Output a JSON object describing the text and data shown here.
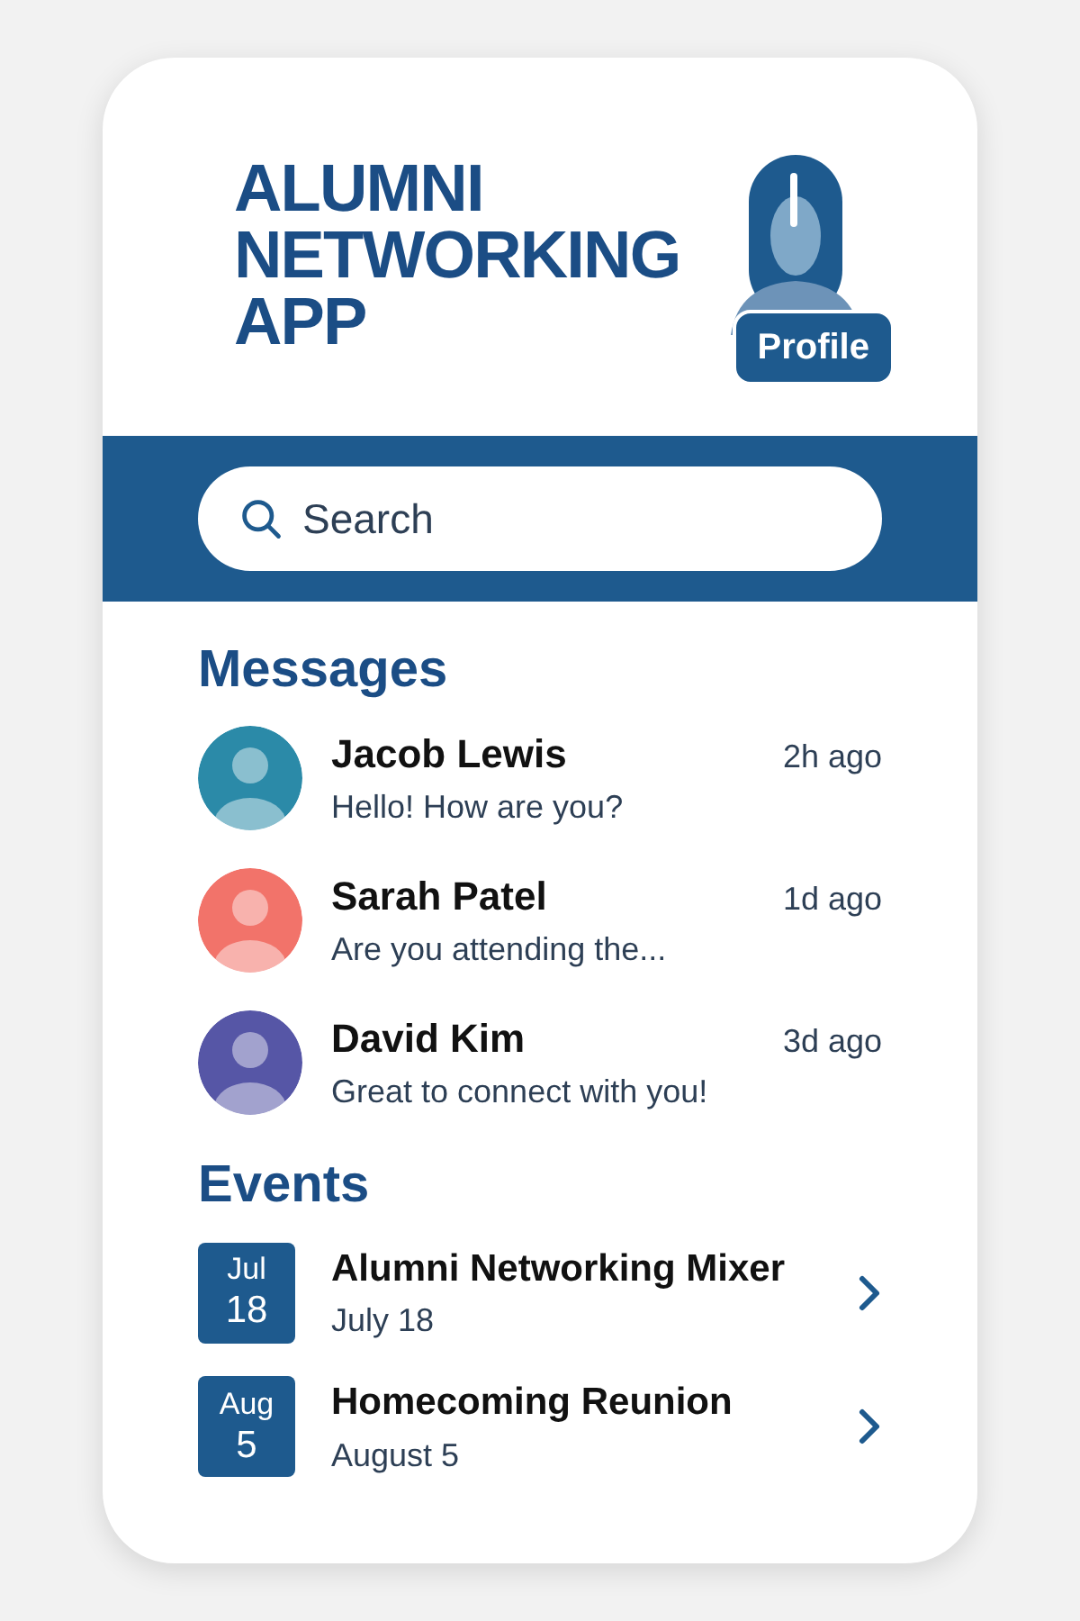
{
  "header": {
    "title": [
      "ALUMNI",
      "NETWORKING",
      "APP"
    ],
    "profile_button": "Profile"
  },
  "search": {
    "placeholder": "Search"
  },
  "messages": {
    "heading": "Messages",
    "items": [
      {
        "name": "Jacob Lewis",
        "time": "2h ago",
        "preview": "Hello! How are you?",
        "color": "#2b8aa8"
      },
      {
        "name": "Sarah Patel",
        "time": "1d ago",
        "preview": "Are you attending the...",
        "color": "#f2736a"
      },
      {
        "name": "David Kim",
        "time": "3d ago",
        "preview": "Great to connect with you!",
        "color": "#5656a6"
      }
    ]
  },
  "events": {
    "heading": "Events",
    "items": [
      {
        "month": "Jul",
        "day": "18",
        "title": "Alumni Networking Mixer",
        "date": "July 18"
      },
      {
        "month": "Aug",
        "day": "5",
        "title": "Homecoming Reunion",
        "date": "August 5"
      }
    ]
  }
}
